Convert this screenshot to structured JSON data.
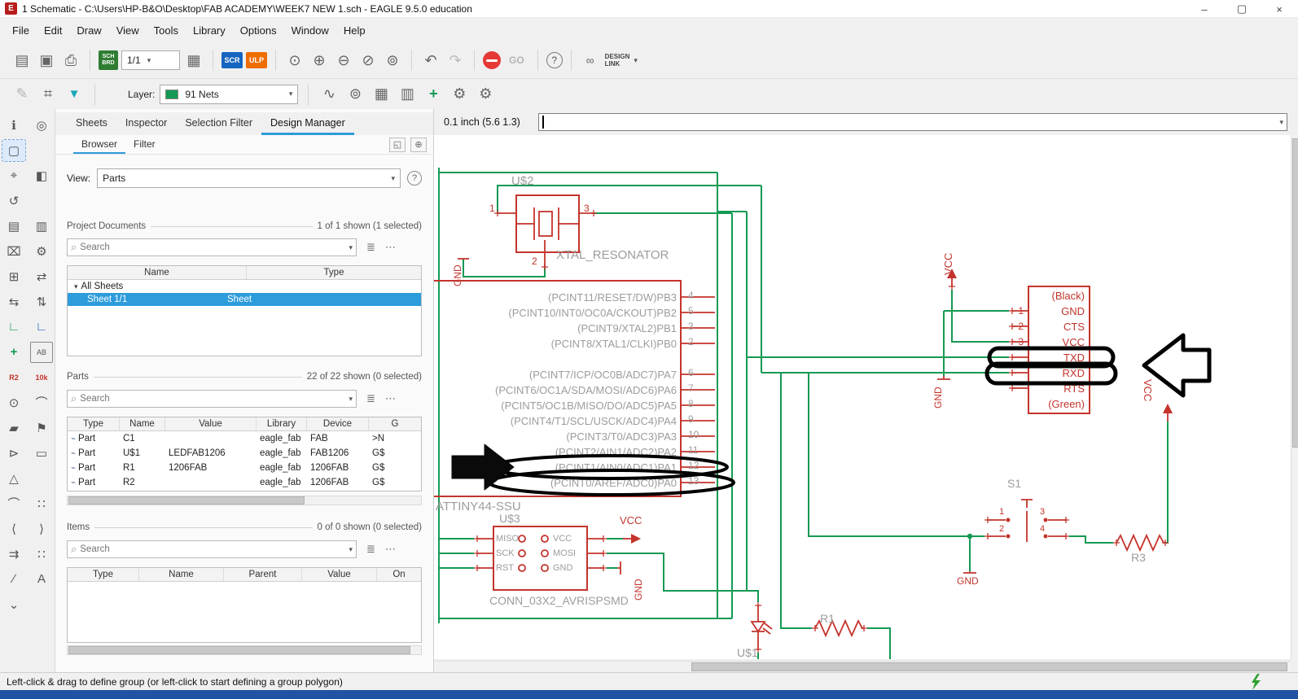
{
  "window": {
    "title": "1 Schematic - C:\\Users\\HP-B&O\\Desktop\\FAB ACADEMY\\WEEK7 NEW 1.sch - EAGLE 9.5.0 education"
  },
  "icons": {
    "app": "E",
    "minimize": "–",
    "maximize": "▢",
    "close": "×",
    "open": "▤",
    "save": "▣",
    "print": "⎙",
    "grid": "▦",
    "dropdown": "▾",
    "zoom_fit": "⊙",
    "zoom_in": "⊕",
    "zoom_out": "⊖",
    "zoom_select": "⊘",
    "zoom_redraw": "⊚",
    "undo": "↶",
    "redo": "↷",
    "help": "?",
    "link": "∞",
    "pencil": "✎",
    "hash": "⌗",
    "funnel": "▼",
    "sine": "∿",
    "target": "⊚",
    "package": "▦",
    "package2": "▥",
    "plus": "+",
    "gear": "⚙",
    "search": "⌕",
    "list": "≣",
    "more": "⋯",
    "expander": "▾",
    "part": "⌁",
    "mini1": "◱",
    "mini2": "⊕",
    "lightning": "⚡"
  },
  "menubar": [
    "File",
    "Edit",
    "Draw",
    "View",
    "Tools",
    "Library",
    "Options",
    "Window",
    "Help"
  ],
  "toolbar1": {
    "sch": "SCH",
    "brd": "BRD",
    "sheet_value": "1/1",
    "scr": "SCR",
    "ulp": "ULP",
    "go": "GO",
    "design_link_1": "DESIGN",
    "design_link_2": "LINK"
  },
  "toolbar2": {
    "layer_label": "Layer:",
    "layer_value": "91 Nets"
  },
  "left_tools": [
    {
      "name": "info-tool",
      "glyph": "ℹ"
    },
    {
      "name": "eye-tool",
      "glyph": "◎"
    },
    {
      "name": "group-tool",
      "glyph": "▢",
      "active": true
    },
    {
      "name": "spacer",
      "glyph": ""
    },
    {
      "name": "move-tool",
      "glyph": "⌖"
    },
    {
      "name": "mirror-tool",
      "glyph": "◧"
    },
    {
      "name": "rotate-tool",
      "glyph": "↺"
    },
    {
      "name": "spacer",
      "glyph": ""
    },
    {
      "name": "copy-tool",
      "glyph": "▤"
    },
    {
      "name": "paste-tool",
      "glyph": "▥"
    },
    {
      "name": "delete-tool",
      "glyph": "⌧"
    },
    {
      "name": "wrench-tool",
      "glyph": "⚙"
    },
    {
      "name": "add-part-tool",
      "glyph": "⊞"
    },
    {
      "name": "replace-tool",
      "glyph": "⇄"
    },
    {
      "name": "pinswap-tool",
      "glyph": "⇆"
    },
    {
      "name": "gateswap-tool",
      "glyph": "⇅"
    },
    {
      "name": "net-tool",
      "glyph": "∟",
      "css": "color:#149a54;font-weight:bold"
    },
    {
      "name": "bus-tool",
      "glyph": "∟",
      "css": "color:#1565c0;font-weight:bold"
    },
    {
      "name": "junction-tool",
      "glyph": "+",
      "css": "color:#149a54;font-weight:bold"
    },
    {
      "name": "label-tool",
      "glyph": "AB",
      "css": "font-size:9px;border:1px solid #888;padding:0 1px"
    },
    {
      "name": "name-tool",
      "glyph": "R2",
      "css": "color:#c4342c;font-size:9px;font-weight:bold"
    },
    {
      "name": "value-tool",
      "glyph": "10k",
      "css": "color:#c4342c;font-size:9px;font-weight:bold"
    },
    {
      "name": "smash-tool",
      "glyph": "⊙"
    },
    {
      "name": "miter-tool",
      "glyph": "⌒"
    },
    {
      "name": "paint-tool",
      "glyph": "▰"
    },
    {
      "name": "attribute-tool",
      "glyph": "⚑"
    },
    {
      "name": "invoke-tool",
      "glyph": "⊳"
    },
    {
      "name": "rect-tool",
      "glyph": "▭"
    },
    {
      "name": "polygon-tool",
      "glyph": "△"
    },
    {
      "name": "spacer",
      "glyph": ""
    },
    {
      "name": "arc-tool",
      "glyph": "⌒"
    },
    {
      "name": "dots-tool",
      "glyph": "∷"
    },
    {
      "name": "split-left-tool",
      "glyph": "⟨"
    },
    {
      "name": "split-right-tool",
      "glyph": "⟩"
    },
    {
      "name": "erc-tool",
      "glyph": "⇉"
    },
    {
      "name": "errors-tool",
      "glyph": "∷"
    },
    {
      "name": "line-tool",
      "glyph": "∕"
    },
    {
      "name": "text-tool",
      "glyph": "A"
    },
    {
      "name": "more-tool",
      "glyph": "⌄"
    },
    {
      "name": "spacer",
      "glyph": ""
    }
  ],
  "panel": {
    "tabs": [
      {
        "label": "Sheets"
      },
      {
        "label": "Inspector"
      },
      {
        "label": "Selection Filter"
      },
      {
        "label": "Design Manager",
        "active": true
      }
    ],
    "subtabs": [
      {
        "label": "Browser",
        "active": true
      },
      {
        "label": "Filter"
      }
    ],
    "view_label": "View:",
    "view_value": "Parts",
    "project": {
      "title": "Project Documents",
      "count": "1 of 1 shown (1 selected)",
      "search": "Search",
      "col_name": "Name",
      "col_type": "Type",
      "root": "All Sheets",
      "sheet_name": "Sheet 1/1",
      "sheet_type": "Sheet"
    },
    "parts": {
      "title": "Parts",
      "count": "22 of 22 shown (0 selected)",
      "search": "Search",
      "icon": "⌁",
      "columns": [
        "Type",
        "Name",
        "Value",
        "Library",
        "Device",
        "G"
      ],
      "rows": [
        {
          "type": "Part",
          "name": "C1",
          "value": "",
          "library": "eagle_fab",
          "device": "FAB",
          "gate": ">N"
        },
        {
          "type": "Part",
          "name": "U$1",
          "value": "LEDFAB1206",
          "library": "eagle_fab",
          "device": "FAB1206",
          "gate": "G$"
        },
        {
          "type": "Part",
          "name": "R1",
          "value": "1206FAB",
          "library": "eagle_fab",
          "device": "1206FAB",
          "gate": "G$"
        },
        {
          "type": "Part",
          "name": "R2",
          "value": "",
          "library": "eagle_fab",
          "device": "1206FAB",
          "gate": "G$"
        }
      ]
    },
    "items": {
      "title": "Items",
      "count": "0 of 0 shown (0 selected)",
      "search": "Search",
      "columns": [
        "Type",
        "Name",
        "Parent",
        "Value",
        "On"
      ]
    }
  },
  "canvas": {
    "coords": "0.1 inch (5.6 1.3)",
    "vcc": "VCC",
    "gnd": "GND",
    "xtal": {
      "ref": "U$2",
      "name": "XTAL_RESONATOR",
      "pin1": "1",
      "pin2": "2",
      "pin3": "3"
    },
    "mcu": {
      "name": "ATTINY44-SSU",
      "pb_labels": [
        "(PCINT11/RESET/DW)PB3",
        "(PCINT10/INT0/OC0A/CKOUT)PB2",
        "(PCINT9/XTAL2)PB1",
        "(PCINT8/XTAL1/CLKI)PB0"
      ],
      "pb_pins": [
        "4",
        "5",
        "3",
        "2"
      ],
      "pa_labels": [
        "(PCINT7/ICP/OC0B/ADC7)PA7",
        "(PCINT6/OC1A/SDA/MOSI/ADC6)PA6",
        "(PCINT5/OC1B/MISO/DO/ADC5)PA5",
        "(PCINT4/T1/SCL/USCK/ADC4)PA4",
        "(PCINT3/T0/ADC3)PA3",
        "(PCINT2/AIN1/ADC2)PA2",
        "(PCINT1/AIN0/ADC1)PA1",
        "(PCINT0/AREF/ADC0)PA0"
      ],
      "pa_pins": [
        "6",
        "7",
        "8",
        "9",
        "10",
        "11",
        "12",
        "13"
      ]
    },
    "ftdi": {
      "labels": [
        "(Black)",
        "GND",
        "CTS",
        "VCC",
        "TXD",
        "RXD",
        "RTS",
        "(Green)"
      ],
      "pins": [
        "1",
        "2",
        "3"
      ]
    },
    "conn": {
      "ref": "U$3",
      "name": "CONN_03X2_AVRISPSMD",
      "left": [
        "MISO",
        "SCK",
        "RST"
      ],
      "right": [
        "VCC",
        "MOSI",
        "GND"
      ]
    },
    "sw": {
      "ref": "S1",
      "pins": [
        "1",
        "3",
        "2",
        "4"
      ]
    },
    "r1": "R1",
    "r3": "R3",
    "led": "U$1"
  },
  "statusbar": {
    "text": "Left-click & drag to define group (or left-click to start defining a group polygon)"
  }
}
